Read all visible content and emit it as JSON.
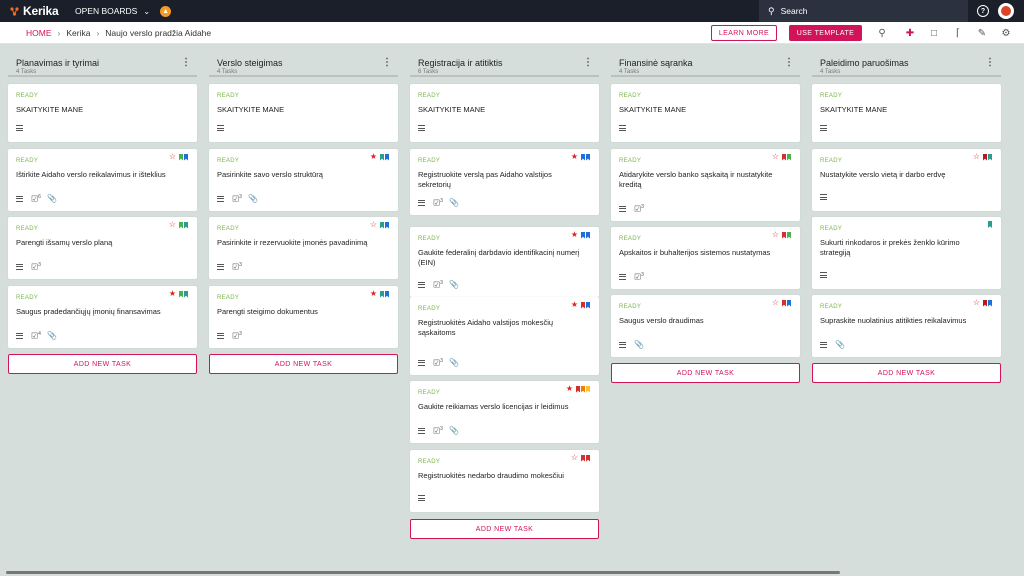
{
  "app": {
    "logo_text": "Kerika",
    "open_boards_label": "OPEN BOARDS",
    "search_label": "Search",
    "help_label": "?"
  },
  "breadcrumb": {
    "home": "HOME",
    "account": "Kerika",
    "board": "Naujo verslo pradžia Aidahe"
  },
  "actions": {
    "learn_more": "LEARN MORE",
    "use_template": "USE TEMPLATE"
  },
  "colors": {
    "accent": "#d1145a",
    "ready": "#7ab648",
    "star": "#e02020",
    "flag_green": "#4caf50",
    "flag_blue": "#1e6fd9",
    "flag_teal": "#2a9d8f",
    "flag_red": "#d32f2f",
    "flag_orange": "#f57c00",
    "flag_yellow": "#fbc02d",
    "flag_darkred": "#b71c1c"
  },
  "add_task_label": "ADD NEW TASK",
  "columns": [
    {
      "title": "Planavimas ir tyrimai",
      "count": "4 Tasks",
      "cards": [
        {
          "status": "READY",
          "title": "SKAITYKITE MANE",
          "checklist": "",
          "attach": false,
          "star": "",
          "flags": []
        },
        {
          "status": "READY",
          "title": "Ištirkite Aidaho verslo reikalavimus ir išteklius",
          "checklist": "6",
          "attach": true,
          "star": "empty",
          "flags": [
            "flag_green",
            "flag_blue"
          ]
        },
        {
          "status": "READY",
          "title": "Parengti išsamų verslo planą",
          "checklist": "3",
          "attach": false,
          "star": "empty",
          "flags": [
            "flag_green",
            "flag_teal"
          ]
        },
        {
          "status": "READY",
          "title": "Saugus pradedančiųjų įmonių finansavimas",
          "checklist": "4",
          "attach": true,
          "star": "filled",
          "flags": [
            "flag_green",
            "flag_teal"
          ]
        }
      ]
    },
    {
      "title": "Verslo steigimas",
      "count": "4 Tasks",
      "cards": [
        {
          "status": "READY",
          "title": "SKAITYKITE MANE",
          "checklist": "",
          "attach": false,
          "star": "",
          "flags": []
        },
        {
          "status": "READY",
          "title": "Pasirinkite savo verslo struktūrą",
          "checklist": "3",
          "attach": true,
          "star": "filled",
          "flags": [
            "flag_teal",
            "flag_blue"
          ]
        },
        {
          "status": "READY",
          "title": "Pasirinkite ir rezervuokite įmonės pavadinimą",
          "checklist": "3",
          "attach": false,
          "star": "empty",
          "flags": [
            "flag_teal",
            "flag_blue"
          ]
        },
        {
          "status": "READY",
          "title": "Parengti steigimo dokumentus",
          "checklist": "3",
          "attach": false,
          "star": "filled",
          "flags": [
            "flag_teal",
            "flag_blue"
          ]
        }
      ]
    },
    {
      "title": "Registracija ir atitiktis",
      "count": "6 Tasks",
      "cards": [
        {
          "status": "READY",
          "title": "SKAITYKITE MANE",
          "checklist": "",
          "attach": false,
          "star": "",
          "flags": []
        },
        {
          "status": "READY",
          "title": "Registruokite verslą pas Aidaho valstijos sekretorių",
          "checklist": "3",
          "attach": true,
          "star": "filled",
          "flags": [
            "flag_blue",
            "flag_blue"
          ]
        },
        {
          "status": "READY",
          "title": "Gaukite federalinį darbdavio identifikacinį numerį (EIN)",
          "checklist": "3",
          "attach": true,
          "star": "filled",
          "flags": [
            "flag_blue",
            "flag_blue"
          ]
        },
        {
          "status": "READY",
          "title": "Registruokitės Aidaho valstijos mokesčių sąskaitoms",
          "checklist": "3",
          "attach": true,
          "star": "filled",
          "flags": [
            "flag_red",
            "flag_blue"
          ]
        },
        {
          "status": "READY",
          "title": "Gaukite reikiamas verslo licencijas ir leidimus",
          "checklist": "3",
          "attach": true,
          "star": "filled",
          "flags": [
            "flag_red",
            "flag_orange",
            "flag_yellow"
          ]
        },
        {
          "status": "READY",
          "title": "Registruokitės nedarbo draudimo mokesčiui",
          "checklist": "",
          "attach": false,
          "star": "empty",
          "flags": [
            "flag_red",
            "flag_red"
          ]
        }
      ]
    },
    {
      "title": "Finansinė sąranka",
      "count": "4 Tasks",
      "cards": [
        {
          "status": "READY",
          "title": "SKAITYKITE MANE",
          "checklist": "",
          "attach": false,
          "star": "",
          "flags": []
        },
        {
          "status": "READY",
          "title": "Atidarykite verslo banko sąskaitą ir nustatykite kreditą",
          "checklist": "3",
          "attach": false,
          "star": "empty",
          "flags": [
            "flag_red",
            "flag_green"
          ]
        },
        {
          "status": "READY",
          "title": "Apskaitos ir buhalterijos sistemos nustatymas",
          "checklist": "3",
          "attach": false,
          "star": "empty",
          "flags": [
            "flag_red",
            "flag_green"
          ]
        },
        {
          "status": "READY",
          "title": "Saugus verslo draudimas",
          "checklist": "",
          "attach": true,
          "star": "empty",
          "flags": [
            "flag_red",
            "flag_blue"
          ]
        }
      ]
    },
    {
      "title": "Paleidimo paruošimas",
      "count": "4 Tasks",
      "cards": [
        {
          "status": "READY",
          "title": "SKAITYKITE MANE",
          "checklist": "",
          "attach": false,
          "star": "",
          "flags": []
        },
        {
          "status": "READY",
          "title": "Nustatykite verslo vietą ir darbo erdvę",
          "checklist": "",
          "attach": false,
          "star": "empty",
          "flags": [
            "flag_darkred",
            "flag_teal"
          ]
        },
        {
          "status": "READY",
          "title": "Sukurti rinkodaros ir prekės ženklo kūrimo strategiją",
          "checklist": "",
          "attach": false,
          "star": "",
          "flags": [
            "flag_teal"
          ]
        },
        {
          "status": "READY",
          "title": "Supraskite nuolatinius atitikties reikalavimus",
          "checklist": "",
          "attach": true,
          "star": "empty",
          "flags": [
            "flag_darkred",
            "flag_blue"
          ]
        }
      ]
    }
  ]
}
